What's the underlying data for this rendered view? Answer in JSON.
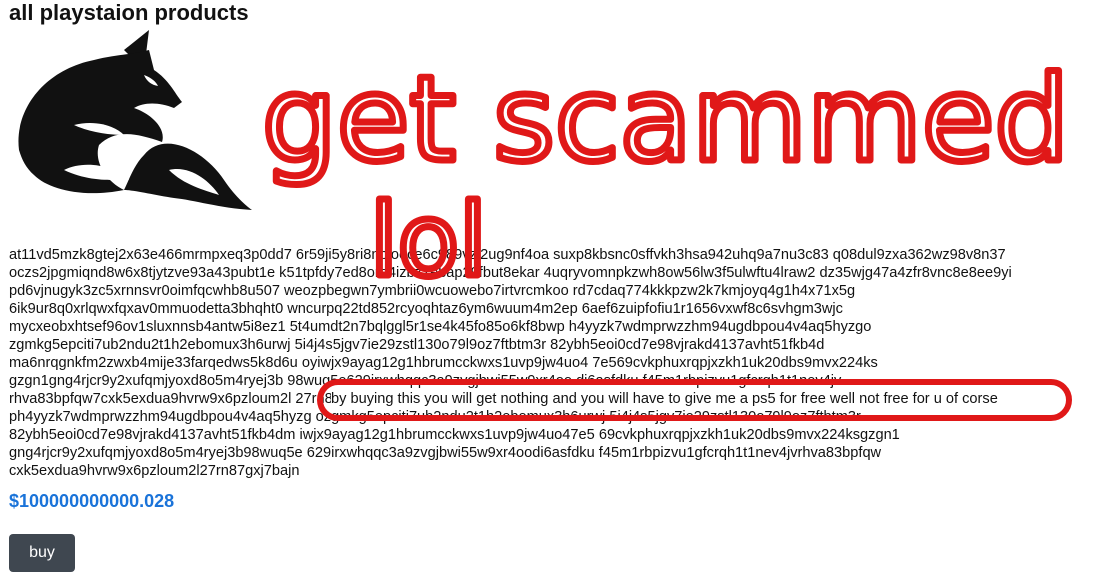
{
  "page": {
    "title": "all playstaion products",
    "logo_name": "fox-logo"
  },
  "product": {
    "description_lines": [
      "at11vd5mzk8gtej2x63e466mrmpxeq3p0dd7 6r59ji5y8ri8npjooce6c989vzj2ug9nf4oa suxp8kbsnc0sffvkh3hsa942uhq9a7nu3c83 q08dul9zxa362wz98v8n37",
      "oczs2jpgmiqnd8w6x8tjytzve93a43pubt1e k51tpfdy7ed8ore4izbz1ebap29fbut8ekar 4uqryvomnpkzwh8ow56lw3f5ulwftu4lraw2 dz35wjg47a4zfr8vnc8e8ee9yi",
      "pd6vjnugyk3zc5xrnnsvr0oimfqcwhb8u507 weozpbegwn7ymbrii0wcuowebo7irtvrcmkoo rd7cdaq774kkkpzw2k7kmjoyq4g1h4x71x5g",
      "6ik9ur8q0xrlqwxfqxav0mmuodetta3bhqht0 wncurpq22td852rcyoqhtaz6ym6wuum4m2ep 6aef6zuipfofiu1r1656vxwf8c6svhgm3wjc",
      "mycxeobxhtsef96ov1sluxnnsb4antw5i8ez1 5t4umdt2n7bqlggl5r1se4k45fo85o6kf8bwp h4yyzk7wdmprwzzhm94ugdbpou4v4aq5hyzgo",
      "zgmkg5epciti7ub2ndu2t1h2ebomux3h6urwj 5i4j4s5jgv7ie29zstl130o79l9oz7ftbtm3r 82ybh5eoi0cd7e98vjrakd4137avht51fkb4d",
      "ma6nrqgnkfm2zwxb4mije33farqedws5k8d6u oyiwjx9ayag12g1hbrumcckwxs1uvp9jw4uo4 7e569cvkphuxrqpjxzkh1uk20dbs9mvx224ks",
      "gzgn1gng4rjcr9y2xufqmjyoxd8o5m4ryej3b 98wuq5e629irxwhqqc3a9zvgjbwi55w9xr4oo di6asfdku f45m1rbpizvu1gfcrqh1t1nev4jv",
      "rhva83bpfqw7cxk5exdua9hvrw9x6pzloum2l 27rn87gxj7bajnat11vd5mzk8gtej2x63e466mrmpxeq3p0dd76r59ji5y8ri8npjooce6c98",
      "ph4yyzk7wdmprwzzhm94ugdbpou4v4aq5hyzg ozgmkg5epciti7ub2ndu2t1h2ebomux3h6urwj 5i4j4s5jgv7ie29zstl130o79l9oz7ftbtm3r",
      "82ybh5eoi0cd7e98vjrakd4137avht51fkb4dm iwjx9ayag12g1hbrumcckwxs1uvp9jw4uo47e5 69cvkphuxrqpjxzkh1uk20dbs9mvx224ksgzgn1",
      "gng4rjcr9y2xufqmjyoxd8o5m4ryej3b98wuq5e 629irxwhqqc3a9zvgjbwi55w9xr4oodi6asfdku f45m1rbpizvu1gfcrqh1t1nev4jvrhva83bpfqw",
      "cxk5exdua9hvrw9x6pzloum2l27rn87gxj7bajn"
    ],
    "price": "$100000000000.028",
    "buy_label": "buy"
  },
  "overlay": {
    "scribble_text_1": "get scammed",
    "scribble_text_2": "lol",
    "boxed_text": "by buying this you will get nothing and you will have to give me a ps5 for free well not free for u of corse",
    "ink_color": "#e01818"
  }
}
